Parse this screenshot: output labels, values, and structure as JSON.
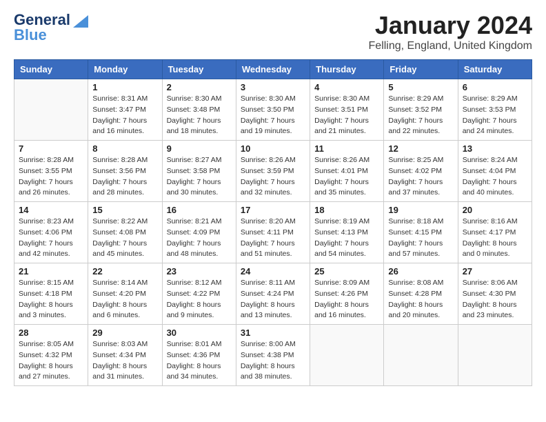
{
  "header": {
    "logo_general": "General",
    "logo_blue": "Blue",
    "month_title": "January 2024",
    "location": "Felling, England, United Kingdom"
  },
  "calendar": {
    "days_of_week": [
      "Sunday",
      "Monday",
      "Tuesday",
      "Wednesday",
      "Thursday",
      "Friday",
      "Saturday"
    ],
    "weeks": [
      [
        {
          "day": "",
          "sunrise": "",
          "sunset": "",
          "daylight": ""
        },
        {
          "day": "1",
          "sunrise": "Sunrise: 8:31 AM",
          "sunset": "Sunset: 3:47 PM",
          "daylight": "Daylight: 7 hours and 16 minutes."
        },
        {
          "day": "2",
          "sunrise": "Sunrise: 8:30 AM",
          "sunset": "Sunset: 3:48 PM",
          "daylight": "Daylight: 7 hours and 18 minutes."
        },
        {
          "day": "3",
          "sunrise": "Sunrise: 8:30 AM",
          "sunset": "Sunset: 3:50 PM",
          "daylight": "Daylight: 7 hours and 19 minutes."
        },
        {
          "day": "4",
          "sunrise": "Sunrise: 8:30 AM",
          "sunset": "Sunset: 3:51 PM",
          "daylight": "Daylight: 7 hours and 21 minutes."
        },
        {
          "day": "5",
          "sunrise": "Sunrise: 8:29 AM",
          "sunset": "Sunset: 3:52 PM",
          "daylight": "Daylight: 7 hours and 22 minutes."
        },
        {
          "day": "6",
          "sunrise": "Sunrise: 8:29 AM",
          "sunset": "Sunset: 3:53 PM",
          "daylight": "Daylight: 7 hours and 24 minutes."
        }
      ],
      [
        {
          "day": "7",
          "sunrise": "Sunrise: 8:28 AM",
          "sunset": "Sunset: 3:55 PM",
          "daylight": "Daylight: 7 hours and 26 minutes."
        },
        {
          "day": "8",
          "sunrise": "Sunrise: 8:28 AM",
          "sunset": "Sunset: 3:56 PM",
          "daylight": "Daylight: 7 hours and 28 minutes."
        },
        {
          "day": "9",
          "sunrise": "Sunrise: 8:27 AM",
          "sunset": "Sunset: 3:58 PM",
          "daylight": "Daylight: 7 hours and 30 minutes."
        },
        {
          "day": "10",
          "sunrise": "Sunrise: 8:26 AM",
          "sunset": "Sunset: 3:59 PM",
          "daylight": "Daylight: 7 hours and 32 minutes."
        },
        {
          "day": "11",
          "sunrise": "Sunrise: 8:26 AM",
          "sunset": "Sunset: 4:01 PM",
          "daylight": "Daylight: 7 hours and 35 minutes."
        },
        {
          "day": "12",
          "sunrise": "Sunrise: 8:25 AM",
          "sunset": "Sunset: 4:02 PM",
          "daylight": "Daylight: 7 hours and 37 minutes."
        },
        {
          "day": "13",
          "sunrise": "Sunrise: 8:24 AM",
          "sunset": "Sunset: 4:04 PM",
          "daylight": "Daylight: 7 hours and 40 minutes."
        }
      ],
      [
        {
          "day": "14",
          "sunrise": "Sunrise: 8:23 AM",
          "sunset": "Sunset: 4:06 PM",
          "daylight": "Daylight: 7 hours and 42 minutes."
        },
        {
          "day": "15",
          "sunrise": "Sunrise: 8:22 AM",
          "sunset": "Sunset: 4:08 PM",
          "daylight": "Daylight: 7 hours and 45 minutes."
        },
        {
          "day": "16",
          "sunrise": "Sunrise: 8:21 AM",
          "sunset": "Sunset: 4:09 PM",
          "daylight": "Daylight: 7 hours and 48 minutes."
        },
        {
          "day": "17",
          "sunrise": "Sunrise: 8:20 AM",
          "sunset": "Sunset: 4:11 PM",
          "daylight": "Daylight: 7 hours and 51 minutes."
        },
        {
          "day": "18",
          "sunrise": "Sunrise: 8:19 AM",
          "sunset": "Sunset: 4:13 PM",
          "daylight": "Daylight: 7 hours and 54 minutes."
        },
        {
          "day": "19",
          "sunrise": "Sunrise: 8:18 AM",
          "sunset": "Sunset: 4:15 PM",
          "daylight": "Daylight: 7 hours and 57 minutes."
        },
        {
          "day": "20",
          "sunrise": "Sunrise: 8:16 AM",
          "sunset": "Sunset: 4:17 PM",
          "daylight": "Daylight: 8 hours and 0 minutes."
        }
      ],
      [
        {
          "day": "21",
          "sunrise": "Sunrise: 8:15 AM",
          "sunset": "Sunset: 4:18 PM",
          "daylight": "Daylight: 8 hours and 3 minutes."
        },
        {
          "day": "22",
          "sunrise": "Sunrise: 8:14 AM",
          "sunset": "Sunset: 4:20 PM",
          "daylight": "Daylight: 8 hours and 6 minutes."
        },
        {
          "day": "23",
          "sunrise": "Sunrise: 8:12 AM",
          "sunset": "Sunset: 4:22 PM",
          "daylight": "Daylight: 8 hours and 9 minutes."
        },
        {
          "day": "24",
          "sunrise": "Sunrise: 8:11 AM",
          "sunset": "Sunset: 4:24 PM",
          "daylight": "Daylight: 8 hours and 13 minutes."
        },
        {
          "day": "25",
          "sunrise": "Sunrise: 8:09 AM",
          "sunset": "Sunset: 4:26 PM",
          "daylight": "Daylight: 8 hours and 16 minutes."
        },
        {
          "day": "26",
          "sunrise": "Sunrise: 8:08 AM",
          "sunset": "Sunset: 4:28 PM",
          "daylight": "Daylight: 8 hours and 20 minutes."
        },
        {
          "day": "27",
          "sunrise": "Sunrise: 8:06 AM",
          "sunset": "Sunset: 4:30 PM",
          "daylight": "Daylight: 8 hours and 23 minutes."
        }
      ],
      [
        {
          "day": "28",
          "sunrise": "Sunrise: 8:05 AM",
          "sunset": "Sunset: 4:32 PM",
          "daylight": "Daylight: 8 hours and 27 minutes."
        },
        {
          "day": "29",
          "sunrise": "Sunrise: 8:03 AM",
          "sunset": "Sunset: 4:34 PM",
          "daylight": "Daylight: 8 hours and 31 minutes."
        },
        {
          "day": "30",
          "sunrise": "Sunrise: 8:01 AM",
          "sunset": "Sunset: 4:36 PM",
          "daylight": "Daylight: 8 hours and 34 minutes."
        },
        {
          "day": "31",
          "sunrise": "Sunrise: 8:00 AM",
          "sunset": "Sunset: 4:38 PM",
          "daylight": "Daylight: 8 hours and 38 minutes."
        },
        {
          "day": "",
          "sunrise": "",
          "sunset": "",
          "daylight": ""
        },
        {
          "day": "",
          "sunrise": "",
          "sunset": "",
          "daylight": ""
        },
        {
          "day": "",
          "sunrise": "",
          "sunset": "",
          "daylight": ""
        }
      ]
    ]
  }
}
